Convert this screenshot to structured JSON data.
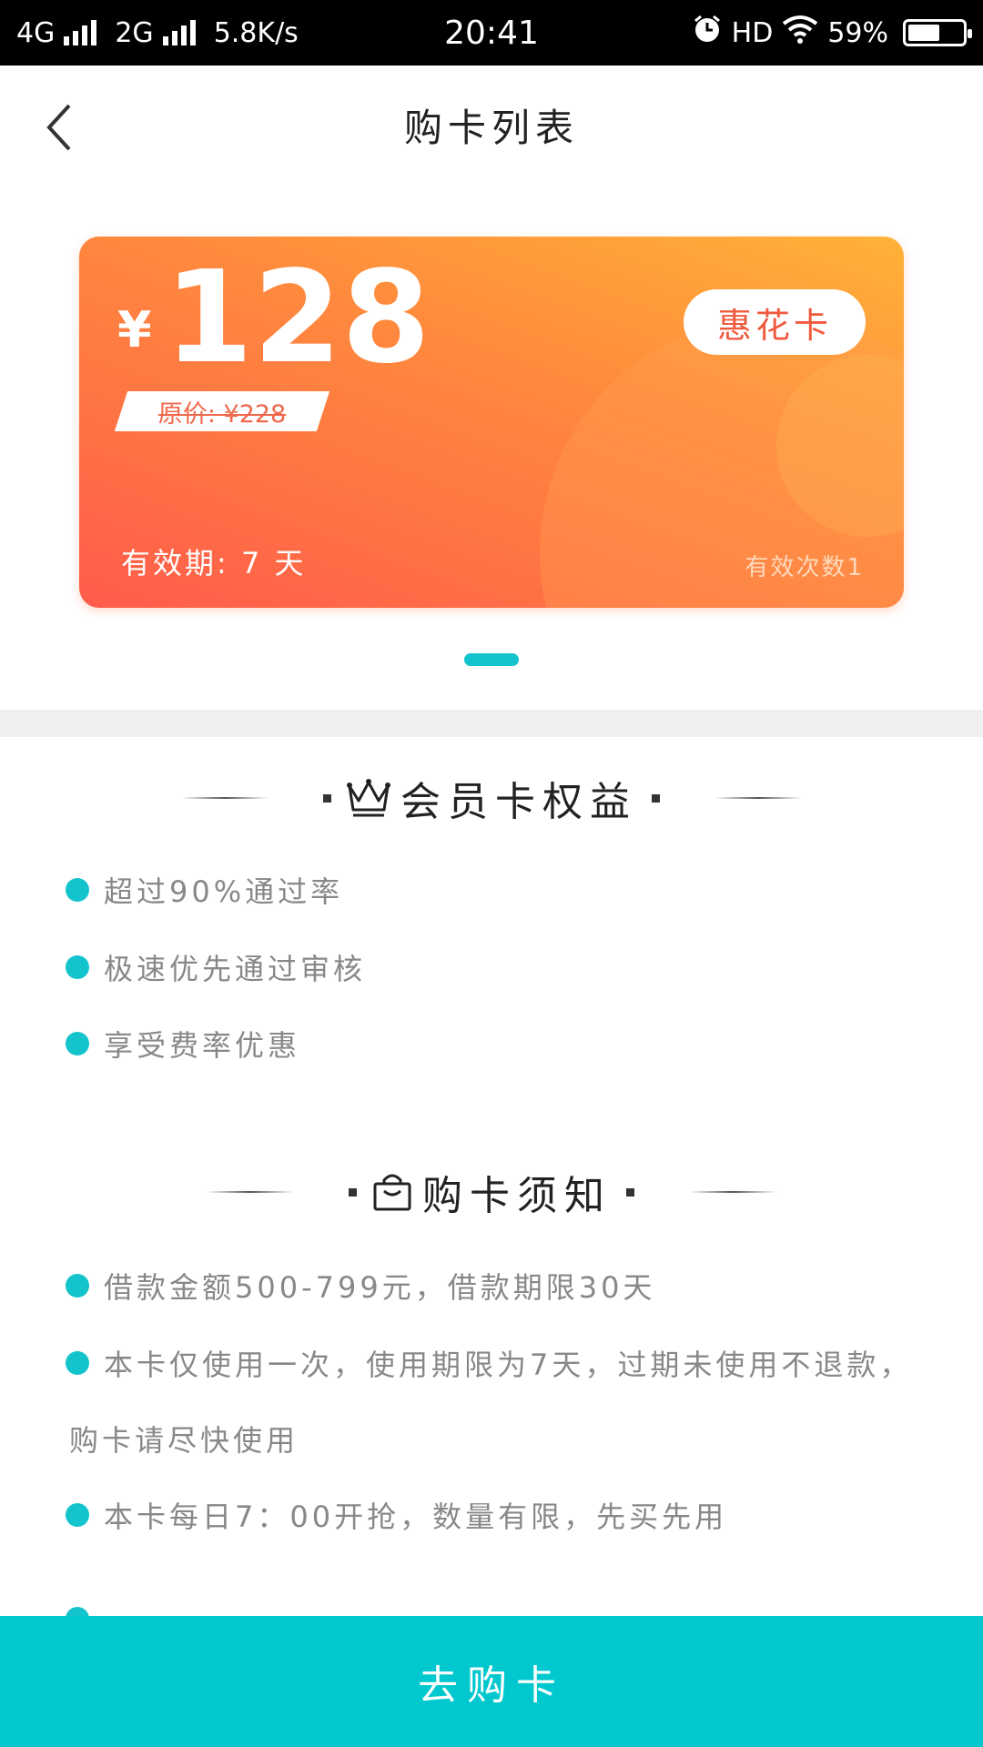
{
  "status_bar": {
    "network_1": "4G",
    "network_2": "2G",
    "speed": "5.8K/s",
    "time": "20:41",
    "hd": "HD",
    "battery": "59%",
    "battery_level": 0.59
  },
  "header": {
    "title": "购卡列表"
  },
  "card": {
    "currency": "¥",
    "price": "128",
    "original_price": "原价: ¥228",
    "tag": "惠花卡",
    "validity": "有效期: 7 天",
    "times": "有效次数1"
  },
  "benefits": {
    "title": "会员卡权益",
    "items": [
      "超过90%通过率",
      "极速优先通过审核",
      "享受费率优惠"
    ]
  },
  "notice": {
    "title": "购卡须知",
    "items": [
      "借款金额500-799元，借款期限30天",
      "本卡仅使用一次，使用期限为7天，过期未使用不退款，",
      "购卡请尽快使用",
      "本卡每日7：00开抢，数量有限，先买先用"
    ]
  },
  "buy_button": {
    "label": "去购卡"
  },
  "colors": {
    "accent": "#00c8ce",
    "card_start": "#ffb238",
    "card_end": "#ff5c4b",
    "tag_text": "#ef5a3e"
  }
}
